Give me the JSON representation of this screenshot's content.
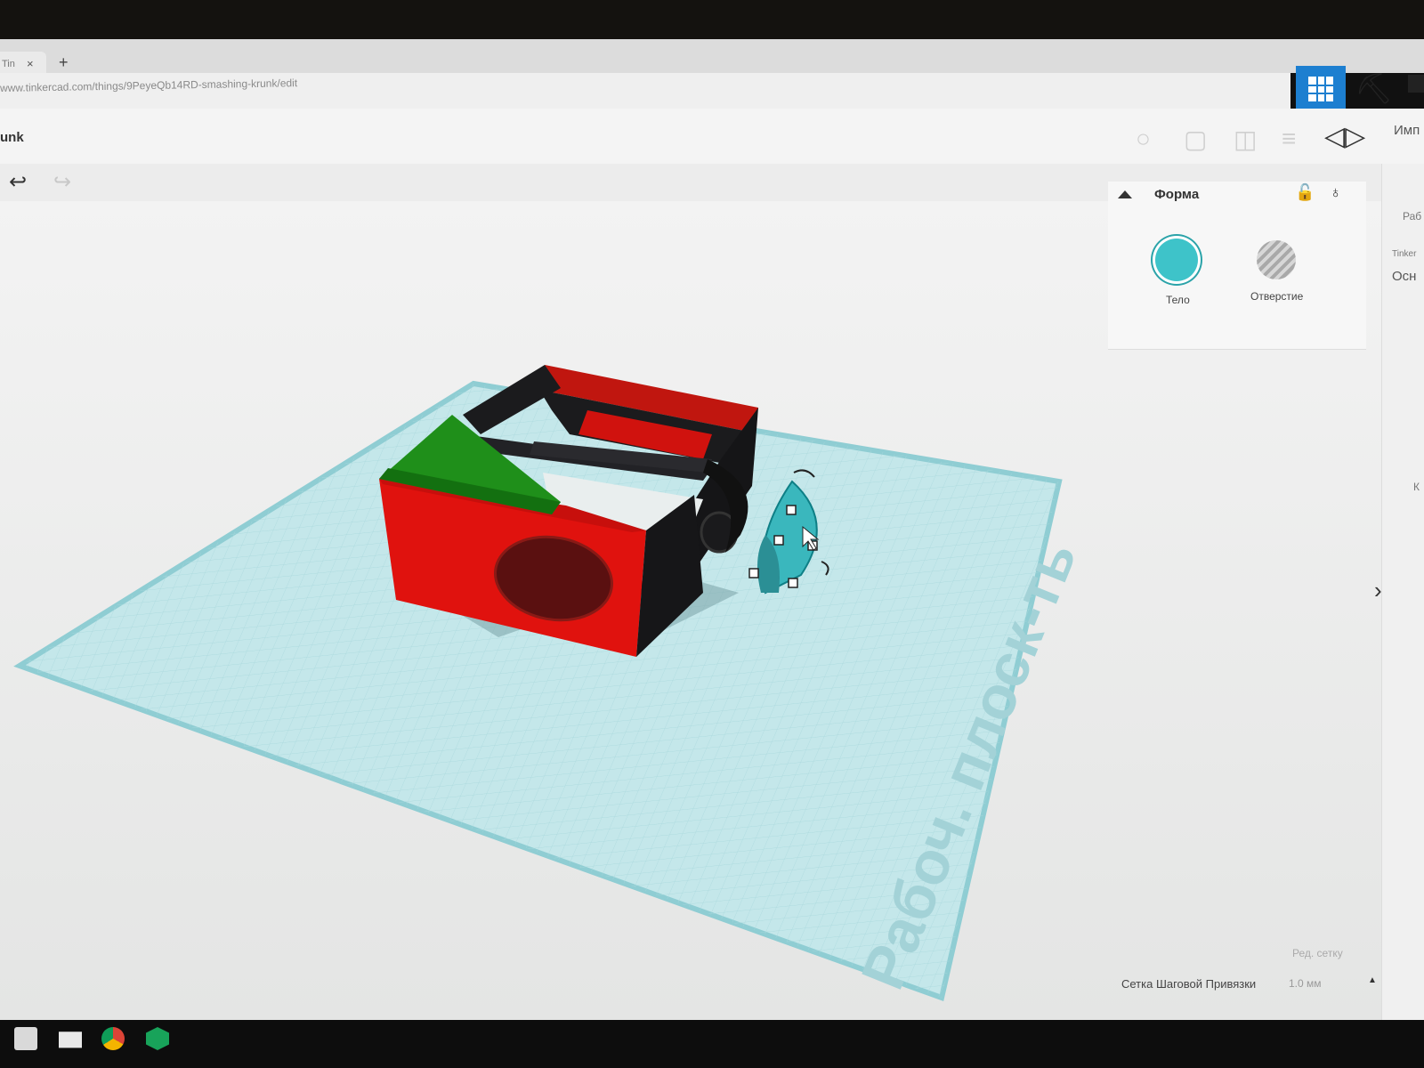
{
  "browser": {
    "tab_title": "Tin",
    "tab_close_icon": "×",
    "new_tab_icon": "+",
    "url": "www.tinkercad.com/things/9PeyeQb14RD-smashing-krunk/edit"
  },
  "header": {
    "project_title": "unk",
    "import_label": "Имп"
  },
  "toolbar": {
    "undo_icon": "undo-arrow",
    "redo_icon": "redo-arrow",
    "mirror_icon": "mirror",
    "tools": [
      "note-icon",
      "group-icon",
      "ungroup-icon",
      "align-icon"
    ]
  },
  "right_strip": {
    "workplane_label": "Раб",
    "category_caption": "Tinker",
    "category_value": "Осн",
    "edge_letter": "К"
  },
  "shape_panel": {
    "title": "Форма",
    "solid_label": "Тело",
    "hole_label": "Отверстие",
    "solid_color": "#3ec3c9"
  },
  "workplane": {
    "label": "Рабоч. плоск-ть"
  },
  "footer": {
    "edit_grid_label": "Ред. сетку",
    "snap_label": "Сетка Шаговой Привязки",
    "snap_value": "1.0 мм"
  },
  "colors": {
    "accent": "#1d7fd0",
    "grid": "#bfe3e6",
    "box_red": "#e0120e",
    "wedge_green": "#1f8f1a",
    "frame_black": "#1b1b1d",
    "selected_shape": "#3ab7bd"
  },
  "taskbar": {
    "icons": [
      "store-icon",
      "mail-icon",
      "chrome-icon",
      "app-icon"
    ]
  }
}
